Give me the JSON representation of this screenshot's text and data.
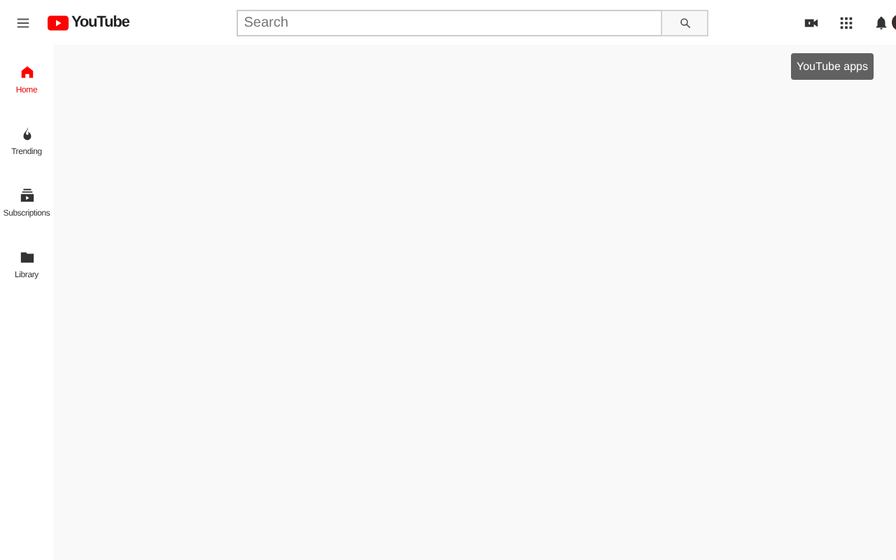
{
  "header": {
    "logo_text": "YouTube",
    "search": {
      "placeholder": "Search"
    }
  },
  "sidebar": {
    "items": [
      {
        "kind": "home",
        "label": "Home",
        "selected": true
      },
      {
        "kind": "trending",
        "label": "Trending",
        "selected": false
      },
      {
        "kind": "subscriptions",
        "label": "Subscriptions",
        "selected": false
      },
      {
        "kind": "library",
        "label": "Library",
        "selected": false
      }
    ]
  },
  "tooltip": "YouTube apps"
}
